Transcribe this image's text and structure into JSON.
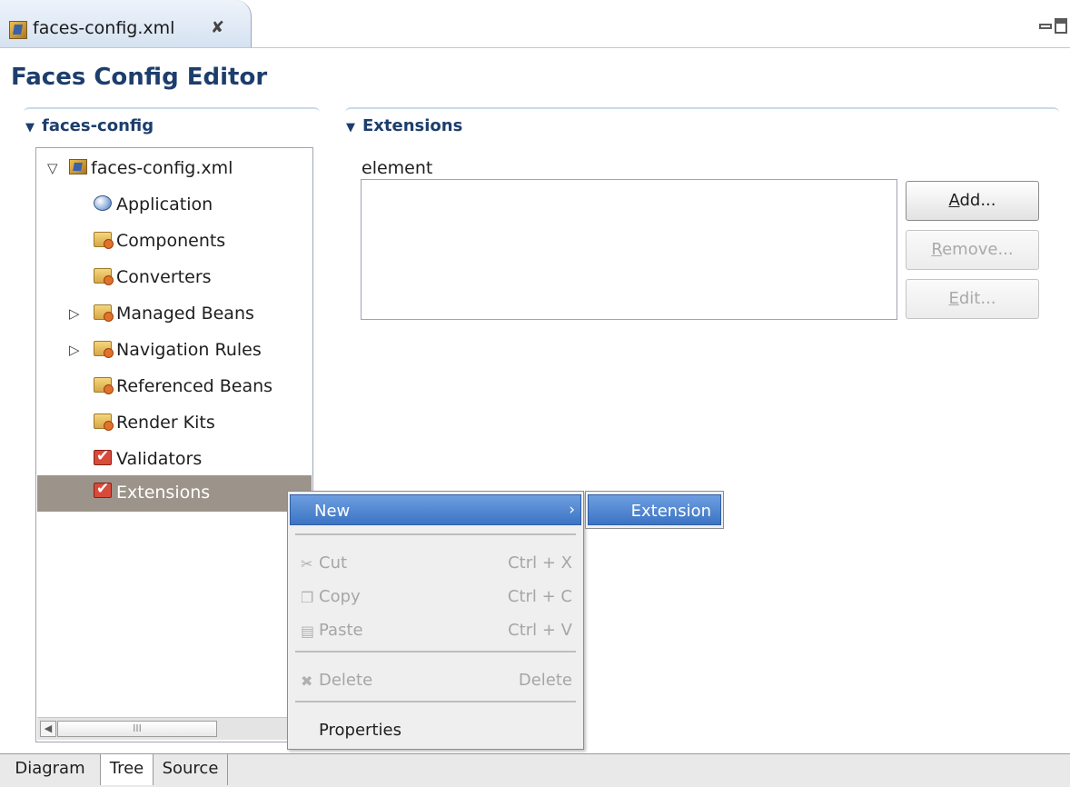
{
  "editor_tab": {
    "label": "faces-config.xml",
    "close_glyph": "✘"
  },
  "window_controls": {
    "minimize_icon": "minimize-icon",
    "maximize_icon": "maximize-icon"
  },
  "editor": {
    "title": "Faces Config Editor"
  },
  "tree_section": {
    "header": "faces-config",
    "root": "faces-config.xml",
    "items": [
      {
        "label": "Application",
        "icon": "application-icon",
        "expandable": false
      },
      {
        "label": "Components",
        "icon": "folder-icon",
        "expandable": false
      },
      {
        "label": "Converters",
        "icon": "folder-icon",
        "expandable": false
      },
      {
        "label": "Managed Beans",
        "icon": "folder-icon",
        "expandable": true
      },
      {
        "label": "Navigation Rules",
        "icon": "folder-icon",
        "expandable": true
      },
      {
        "label": "Referenced Beans",
        "icon": "folder-icon",
        "expandable": false
      },
      {
        "label": "Render Kits",
        "icon": "folder-icon",
        "expandable": false
      },
      {
        "label": "Validators",
        "icon": "check-icon",
        "expandable": false
      },
      {
        "label": "Extensions",
        "icon": "check-icon",
        "expandable": false,
        "selected": true
      }
    ],
    "scrollbar_thumb": "III"
  },
  "extensions_section": {
    "header": "Extensions",
    "list_label": "element",
    "buttons": {
      "add": {
        "mnemonic": "A",
        "rest": "dd..."
      },
      "remove": {
        "mnemonic": "R",
        "rest": "emove..."
      },
      "edit": {
        "mnemonic": "E",
        "rest": "dit..."
      }
    }
  },
  "context_menu": {
    "new": "New",
    "cut": {
      "label": "Cut",
      "accel": "Ctrl + X"
    },
    "copy": {
      "label": "Copy",
      "accel": "Ctrl + C"
    },
    "paste": {
      "label": "Paste",
      "accel": "Ctrl + V"
    },
    "delete": {
      "label": "Delete",
      "accel": "Delete"
    },
    "properties": "Properties",
    "submenu_item": "Extension"
  },
  "page_tabs": [
    "Diagram",
    "Tree",
    "Source"
  ],
  "colors": {
    "section_header": "#1d3e6d",
    "selection": "#9c948a",
    "menu_highlight": "#3c74c4"
  }
}
